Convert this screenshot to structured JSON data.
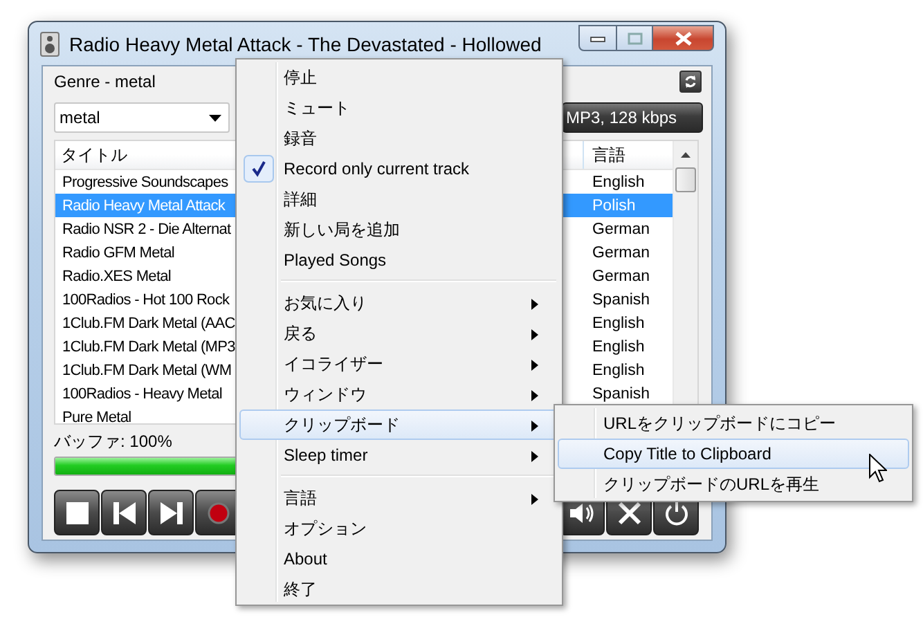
{
  "window": {
    "title": "Radio Heavy Metal Attack - The Devastated - Hollowed"
  },
  "genre_label": "Genre - metal",
  "genre_select": {
    "value": "metal"
  },
  "stream_info": "MP3, 128 kbps",
  "station_list": {
    "columns": [
      "タイトル",
      "言語"
    ],
    "rows": [
      {
        "title": "Progressive Soundscapes",
        "language": "English",
        "selected": false
      },
      {
        "title": "Radio Heavy Metal Attack",
        "language": "Polish",
        "selected": true
      },
      {
        "title": "Radio NSR 2 - Die Alternat",
        "language": "German",
        "selected": false
      },
      {
        "title": "Radio GFM Metal",
        "language": "German",
        "selected": false
      },
      {
        "title": "Radio.XES Metal",
        "language": "German",
        "selected": false
      },
      {
        "title": "100Radios - Hot 100 Rock",
        "language": "Spanish",
        "selected": false
      },
      {
        "title": "1Club.FM Dark Metal (AAC",
        "language": "English",
        "selected": false
      },
      {
        "title": "1Club.FM Dark Metal (MP3",
        "language": "English",
        "selected": false
      },
      {
        "title": "1Club.FM Dark Metal (WM",
        "language": "English",
        "selected": false
      },
      {
        "title": "100Radios - Heavy Metal",
        "language": "Spanish",
        "selected": false
      },
      {
        "title": "Pure Metal",
        "selected": false
      }
    ]
  },
  "buffer": {
    "label": "バッファ: 100%",
    "level": 1.0
  },
  "player_buttons_left": [
    {
      "kind": "stop"
    },
    {
      "kind": "previous"
    },
    {
      "kind": "next"
    },
    {
      "kind": "record"
    }
  ],
  "player_buttons_right": [
    {
      "kind": "volume"
    },
    {
      "kind": "tools"
    },
    {
      "kind": "power"
    }
  ],
  "context_menu": {
    "sections": [
      {
        "items": [
          {
            "label": "停止",
            "checked": false,
            "submenu": false,
            "selected": false
          },
          {
            "label": "ミュート",
            "checked": false,
            "submenu": false,
            "selected": false
          },
          {
            "label": "録音",
            "checked": false,
            "submenu": false,
            "selected": false
          },
          {
            "label": "Record only current track",
            "checked": true,
            "submenu": false,
            "selected": false
          },
          {
            "label": "詳細",
            "checked": false,
            "submenu": false,
            "selected": false
          },
          {
            "label": "新しい局を追加",
            "checked": false,
            "submenu": false,
            "selected": false
          },
          {
            "label": "Played Songs",
            "checked": false,
            "submenu": false,
            "selected": false
          }
        ]
      },
      {
        "items": [
          {
            "label": "お気に入り",
            "checked": false,
            "submenu": true,
            "selected": false
          },
          {
            "label": "戻る",
            "checked": false,
            "submenu": true,
            "selected": false
          },
          {
            "label": "イコライザー",
            "checked": false,
            "submenu": true,
            "selected": false
          },
          {
            "label": "ウィンドウ",
            "checked": false,
            "submenu": true,
            "selected": false
          },
          {
            "label": "クリップボード",
            "checked": false,
            "submenu": true,
            "selected": true
          },
          {
            "label": "Sleep timer",
            "checked": false,
            "submenu": true,
            "selected": false
          }
        ]
      },
      {
        "items": [
          {
            "label": "言語",
            "checked": false,
            "submenu": true,
            "selected": false
          },
          {
            "label": "オプション",
            "checked": false,
            "submenu": false,
            "selected": false
          },
          {
            "label": "About",
            "checked": false,
            "submenu": false,
            "selected": false
          },
          {
            "label": "終了",
            "checked": false,
            "submenu": false,
            "selected": false
          }
        ]
      }
    ]
  },
  "submenu": {
    "items": [
      {
        "label": "URLをクリップボードにコピー",
        "selected": false
      },
      {
        "label": "Copy Title to Clipboard",
        "selected": true
      },
      {
        "label": "クリップボードのURLを再生",
        "selected": false
      }
    ]
  }
}
